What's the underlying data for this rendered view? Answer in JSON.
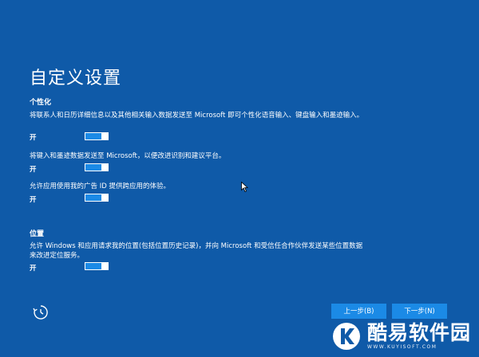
{
  "page": {
    "title": "自定义设置"
  },
  "personalization": {
    "heading": "个性化",
    "items": [
      {
        "description": "将联系人和日历详细信息以及其他相关输入数据发送至 Microsoft 即可个性化语音输入、键盘输入和墨迹输入。",
        "state": "开"
      },
      {
        "description": "将键入和墨迹数据发送至 Microsoft，以便改进识别和建议平台。",
        "state": "开"
      },
      {
        "description": "允许应用使用我的广告 ID 提供跨应用的体验。",
        "state": "开"
      }
    ]
  },
  "location": {
    "heading": "位置",
    "items": [
      {
        "description": "允许 Windows 和应用请求我的位置(包括位置历史记录)，并向 Microsoft 和受信任合作伙伴发送某些位置数据来改进定位服务。",
        "state": "开"
      }
    ]
  },
  "footer": {
    "accessibility_icon": "ease-of-access-icon",
    "back_label": "上一步(B)",
    "next_label": "下一步(N)"
  },
  "watermark": {
    "logo_icon": "k-logo-icon",
    "name": "酷易软件园",
    "url": "WWW.KUYISOFT.COM"
  },
  "colors": {
    "background": "#0f5aa8",
    "accent": "#1b8ae6",
    "text": "#ffffff"
  }
}
